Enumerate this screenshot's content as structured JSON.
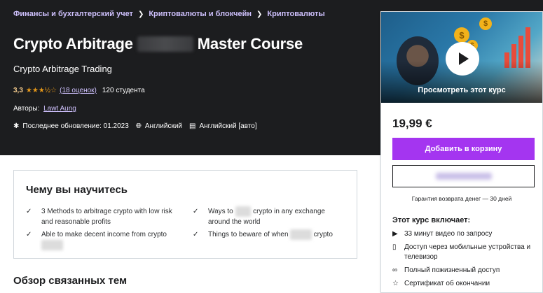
{
  "breadcrumb": [
    "Финансы и бухгалтерский учет",
    "Криптовалюты и блокчейн",
    "Криптовалюты"
  ],
  "course": {
    "title_start": "Crypto Arbitrage",
    "title_end": "Master Course",
    "subtitle": "Crypto Arbitrage Trading",
    "rating": "3,3",
    "stars": "★★★½☆",
    "reviews": "(18 оценок)",
    "students": "120 студента",
    "authors_label": "Авторы:",
    "author": "Lawt Aung",
    "updated": "Последнее обновление: 01.2023",
    "language": "Английский",
    "captions": "Английский [авто]"
  },
  "sidebar": {
    "preview_label": "Просмотреть этот курс",
    "price": "19,99 €",
    "cart_button": "Добавить в корзину",
    "guarantee": "Гарантия возврата денег — 30 дней",
    "includes_title": "Этот курс включает:",
    "includes": [
      {
        "icon": "video-icon",
        "text": "33 минут видео по запросу"
      },
      {
        "icon": "mobile-icon",
        "text": "Доступ через мобильные устройства и телевизор"
      },
      {
        "icon": "infinity-icon",
        "text": "Полный пожизненный доступ"
      },
      {
        "icon": "trophy-icon",
        "text": "Сертификат об окончании"
      }
    ]
  },
  "learn": {
    "title": "Чему вы научитесь",
    "items": [
      "3 Methods to arbitrage crypto with low risk and reasonable profits",
      "Ways to",
      "crypto in any exchange around the world",
      "Able to make decent income from crypto",
      "Things to beware of when",
      "crypto"
    ]
  },
  "related_title": "Обзор связанных тем",
  "colors": {
    "hero_bg": "#1c1d1f",
    "accent": "#a435f0",
    "link": "#cec0fc",
    "star": "#e59819"
  }
}
